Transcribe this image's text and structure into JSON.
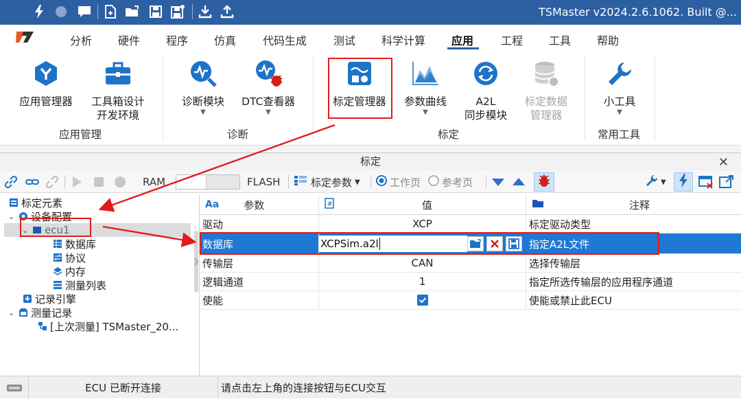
{
  "app": {
    "window_title": "TSMaster v2024.2.6.1062. Built @..."
  },
  "menu": [
    "分析",
    "硬件",
    "程序",
    "仿真",
    "代码生成",
    "测试",
    "科学计算",
    "应用",
    "工程",
    "工具",
    "帮助"
  ],
  "menu_active": "应用",
  "ribbon": {
    "buttons": [
      {
        "line1": "应用管理器",
        "line2": "",
        "icon": "app-manager-icon"
      },
      {
        "line1": "工具箱设计",
        "line2": "开发环境",
        "icon": "toolbox-icon"
      },
      {
        "line1": "诊断模块",
        "line2": "",
        "icon": "diagnostic-icon"
      },
      {
        "line1": "DTC查看器",
        "line2": "",
        "icon": "dtc-viewer-icon"
      },
      {
        "line1": "标定管理器",
        "line2": "",
        "icon": "calibration-manager-icon"
      },
      {
        "line1": "参数曲线",
        "line2": "",
        "icon": "parameter-curve-icon"
      },
      {
        "line1": "A2L",
        "line2": "同步模块",
        "icon": "a2l-sync-icon"
      },
      {
        "line1": "标定数据",
        "line2": "管理器",
        "icon": "calibration-data-icon"
      },
      {
        "line1": "小工具",
        "line2": "",
        "icon": "wrench-icon"
      }
    ],
    "groups": [
      "应用管理",
      "诊断",
      "标定",
      "常用工具"
    ]
  },
  "calib_window": {
    "title": "标定",
    "toolbar": {
      "ram": "RAM",
      "flash": "FLASH",
      "params": "标定参数",
      "work_page": "工作页",
      "ref_page": "参考页"
    },
    "tree": [
      {
        "label": "标定元素",
        "icon": "calibration-elements-icon"
      },
      {
        "label": "设备配置",
        "icon": "device-config-icon"
      },
      {
        "label": "ecu1",
        "icon": "ecu-icon"
      },
      {
        "label": "数据库",
        "icon": "database-icon"
      },
      {
        "label": "协议",
        "icon": "protocol-icon"
      },
      {
        "label": "内存",
        "icon": "memory-icon"
      },
      {
        "label": "测量列表",
        "icon": "measurement-list-icon"
      },
      {
        "label": "记录引擎",
        "icon": "record-engine-icon"
      },
      {
        "label": "测量记录",
        "icon": "measurement-record-icon"
      },
      {
        "label": "[上次测量] TSMaster_20...",
        "icon": "measurement-file-icon"
      }
    ],
    "grid": {
      "headers": {
        "param": "参数",
        "value": "值",
        "note": "注释"
      },
      "rows": [
        {
          "param": "驱动",
          "value": "XCP",
          "note": "标定驱动类型"
        },
        {
          "param": "数据库",
          "value": "XCPSim.a2l",
          "note": "指定A2L文件"
        },
        {
          "param": "传输层",
          "value": "CAN",
          "note": "选择传输层"
        },
        {
          "param": "逻辑通道",
          "value": "1",
          "note": "指定所选传输层的应用程序通道"
        },
        {
          "param": "使能",
          "value": "",
          "note": "使能或禁止此ECU"
        }
      ]
    },
    "status": {
      "connection": "ECU 已断开连接",
      "hint": "请点击左上角的连接按钮与ECU交互"
    }
  },
  "colors": {
    "title_bar": "#2d5fa3",
    "selection": "#1e78d4",
    "annotation": "#e21b1b",
    "accent": "#1e73c8"
  }
}
